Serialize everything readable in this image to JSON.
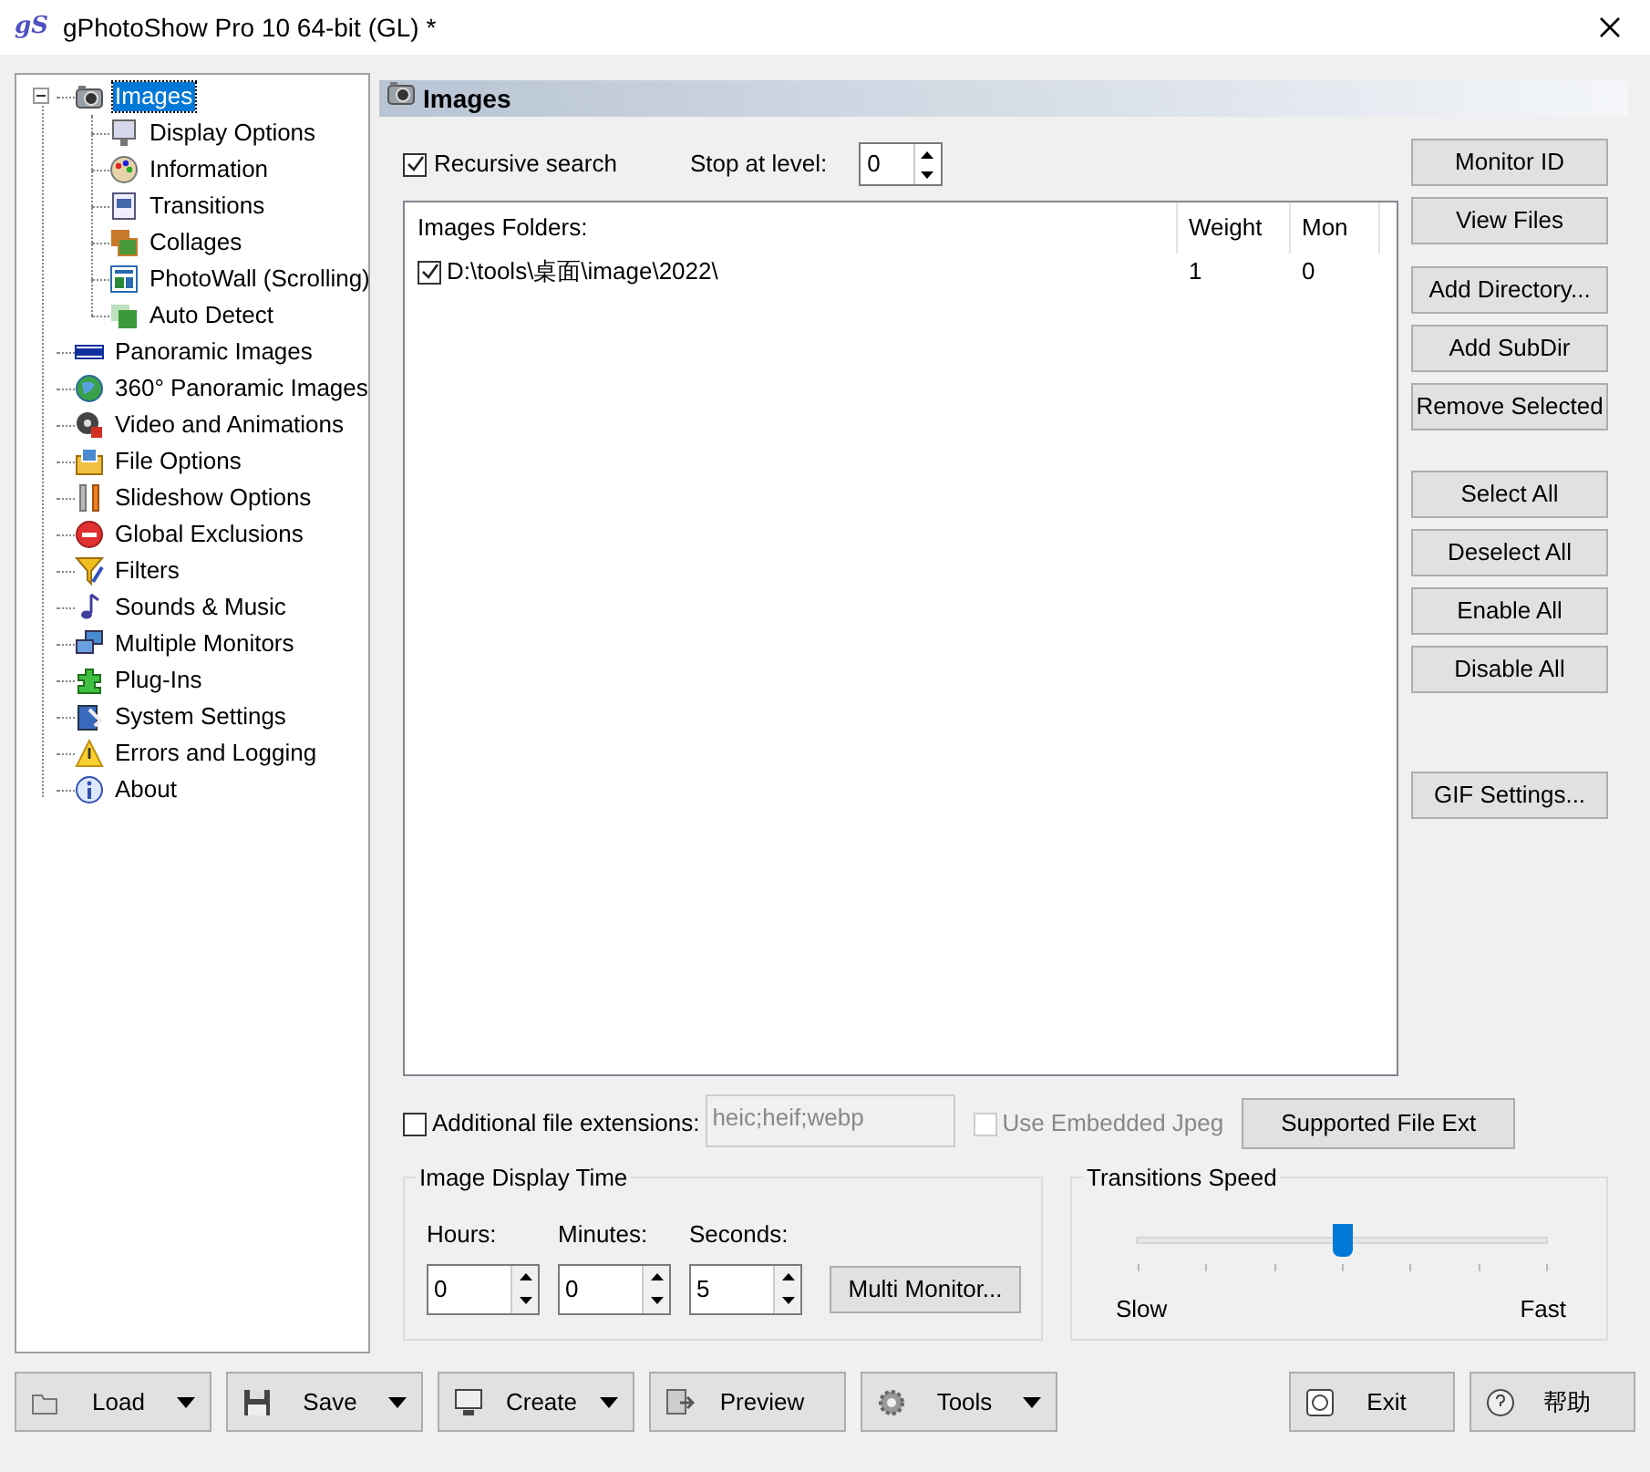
{
  "window": {
    "title": "gPhotoShow Pro 10 64-bit (GL) *",
    "logo": "gS"
  },
  "tree": [
    {
      "label": "Images",
      "selected": true,
      "expanded": true,
      "children": [
        {
          "label": "Display Options",
          "selected": false
        },
        {
          "label": "Information",
          "selected": false
        },
        {
          "label": "Transitions",
          "selected": false
        },
        {
          "label": "Collages",
          "selected": false
        },
        {
          "label": "PhotoWall (Scrolling)",
          "selected": false
        },
        {
          "label": "Auto Detect",
          "selected": false
        }
      ]
    },
    {
      "label": "Panoramic Images",
      "selected": false
    },
    {
      "label": "360° Panoramic Images",
      "selected": false
    },
    {
      "label": "Video and Animations",
      "selected": false
    },
    {
      "label": "File Options",
      "selected": false
    },
    {
      "label": "Slideshow Options",
      "selected": false
    },
    {
      "label": "Global Exclusions",
      "selected": false
    },
    {
      "label": "Filters",
      "selected": false
    },
    {
      "label": "Sounds & Music",
      "selected": false
    },
    {
      "label": "Multiple Monitors",
      "selected": false
    },
    {
      "label": "Plug-Ins",
      "selected": false
    },
    {
      "label": "System Settings",
      "selected": false
    },
    {
      "label": "Errors and Logging",
      "selected": false
    },
    {
      "label": "About",
      "selected": false
    }
  ],
  "panel": {
    "title": "Images"
  },
  "recursive_search": {
    "label": "Recursive search",
    "checked": true
  },
  "stop_level": {
    "label": "Stop at level:",
    "value": "0"
  },
  "folders": {
    "columns": [
      "Images Folders:",
      "Weight",
      "Mon"
    ],
    "rows": [
      {
        "checked": true,
        "path": "D:\\tools\\桌面\\image\\2022\\",
        "weight": "1",
        "mon": "0"
      }
    ]
  },
  "side_button_groups": [
    [
      "Monitor ID",
      "View Files"
    ],
    [
      "Add Directory...",
      "Add SubDir",
      "Remove Selected"
    ],
    [
      "Select All",
      "Deselect All",
      "Enable All",
      "Disable All"
    ],
    [
      "GIF Settings..."
    ]
  ],
  "extensions": {
    "label": "Additional file extensions:",
    "checked": false,
    "value": "heic;heif;webp",
    "disabled": true
  },
  "embedded_jpeg": {
    "label": "Use Embedded Jpeg",
    "checked": false,
    "disabled": true
  },
  "supported_button": "Supported File Ext",
  "display_time": {
    "title": "Image Display Time",
    "fields": [
      {
        "label": "Hours:",
        "value": "0"
      },
      {
        "label": "Minutes:",
        "value": "0"
      },
      {
        "label": "Seconds:",
        "value": "5"
      }
    ],
    "button": "Multi Monitor..."
  },
  "transitions_speed": {
    "title": "Transitions Speed",
    "level": 0.5,
    "min_label": "Slow",
    "max_label": "Fast"
  },
  "toolbar": [
    {
      "label": "Load",
      "dropdown": true
    },
    {
      "label": "Save",
      "dropdown": true
    },
    {
      "label": "Create",
      "dropdown": true
    },
    {
      "label": "Preview",
      "dropdown": false
    },
    {
      "label": "Tools",
      "dropdown": true
    }
  ],
  "footer_buttons": [
    "Exit",
    "帮助"
  ]
}
